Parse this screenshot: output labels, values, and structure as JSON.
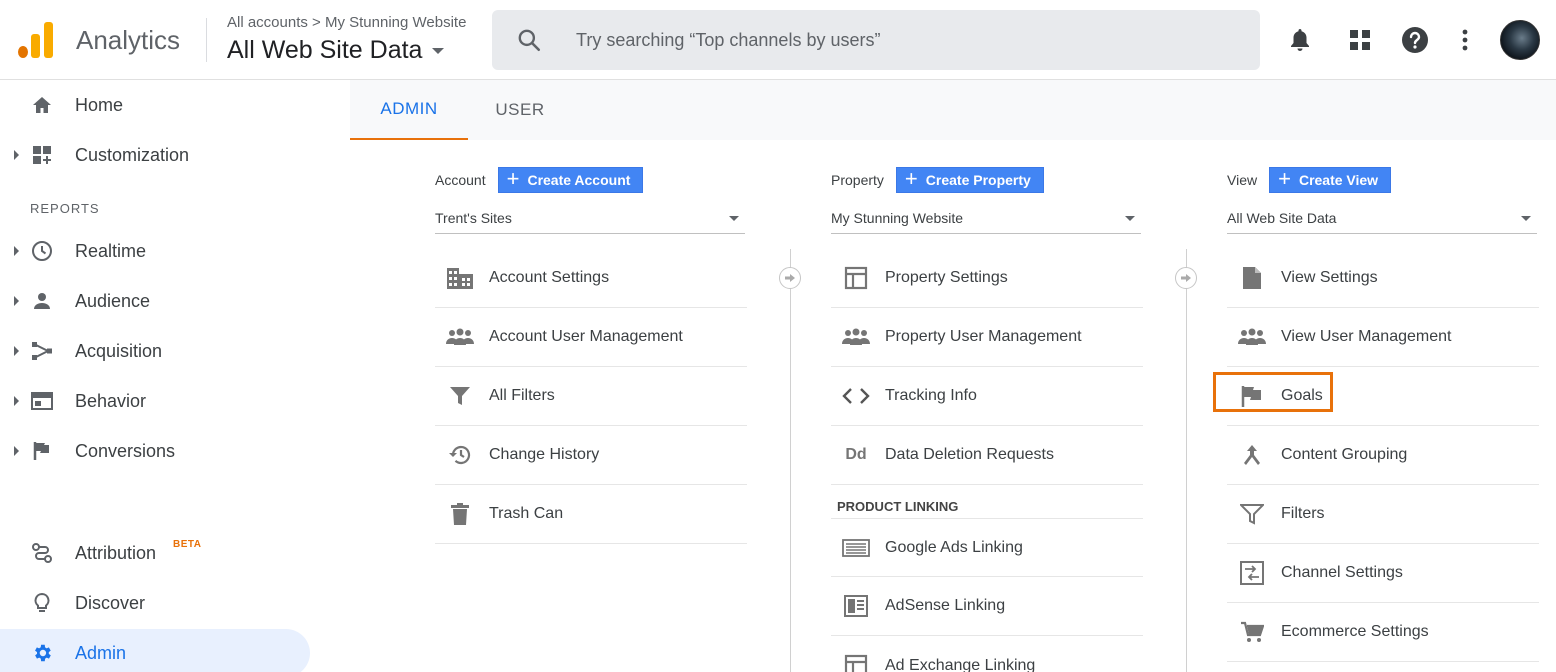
{
  "header": {
    "app_name": "Analytics",
    "breadcrumb": "All accounts > My Stunning Website",
    "view_name": "All Web Site Data",
    "search_placeholder": "Try searching “Top channels by users”",
    "icons": [
      "bell-icon",
      "apps-grid-icon",
      "help-icon",
      "more-vert-icon"
    ],
    "brand_colors": {
      "orange": "#f9ab00",
      "dark_orange": "#e37400"
    }
  },
  "sidebar": {
    "home": "Home",
    "customization": "Customization",
    "reports_heading": "REPORTS",
    "realtime": "Realtime",
    "audience": "Audience",
    "acquisition": "Acquisition",
    "behavior": "Behavior",
    "conversions": "Conversions",
    "attribution": "Attribution",
    "attribution_badge": "BETA",
    "discover": "Discover",
    "admin": "Admin"
  },
  "tabs": {
    "admin": "ADMIN",
    "user": "USER"
  },
  "account": {
    "label": "Account",
    "create": "Create Account",
    "selected": "Trent's Sites",
    "items": [
      "Account Settings",
      "Account User Management",
      "All Filters",
      "Change History",
      "Trash Can"
    ]
  },
  "property": {
    "label": "Property",
    "create": "Create Property",
    "selected": "My Stunning Website",
    "items": [
      "Property Settings",
      "Property User Management",
      "Tracking Info",
      "Data Deletion Requests"
    ],
    "linking_heading": "PRODUCT LINKING",
    "linking_items": [
      "Google Ads Linking",
      "AdSense Linking",
      "Ad Exchange Linking"
    ]
  },
  "view": {
    "label": "View",
    "create": "Create View",
    "selected": "All Web Site Data",
    "items": [
      "View Settings",
      "View User Management",
      "Goals",
      "Content Grouping",
      "Filters",
      "Channel Settings",
      "Ecommerce Settings"
    ],
    "highlight_color": "#e8710a"
  },
  "colors": {
    "accent": "#1a73e8",
    "button": "#4285f4",
    "active_nav_bg": "#e8f0fe"
  }
}
